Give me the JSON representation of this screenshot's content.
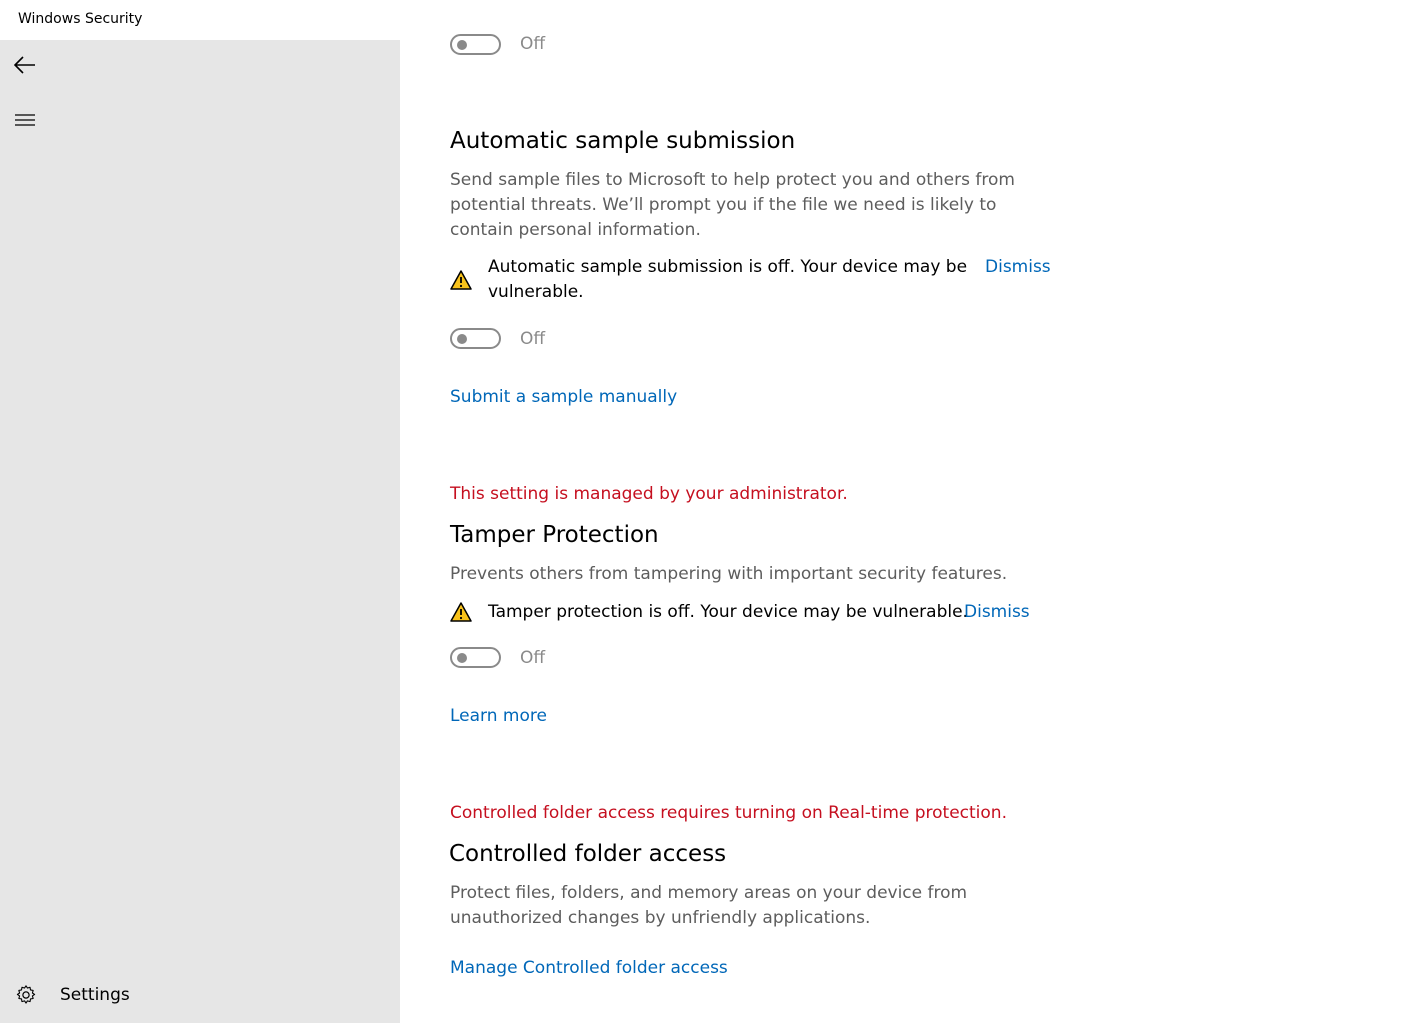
{
  "window": {
    "title": "Windows Security"
  },
  "sidebar": {
    "back_icon": "back-arrow-icon",
    "menu_icon": "hamburger-menu-icon",
    "settings_icon": "gear-icon",
    "settings_label": "Settings"
  },
  "colors": {
    "link": "#0067b8",
    "admin_note": "#c50f1f",
    "warning_icon": "#f8c21b",
    "sidebar_bg": "#e6e6e6"
  },
  "top_toggle": {
    "state": "Off"
  },
  "sample_submission": {
    "heading": "Automatic sample submission",
    "description": "Send sample files to Microsoft to help protect you and others from potential threats. We’ll prompt you if the file we need is likely to contain personal information.",
    "warning_icon": "warning-triangle-icon",
    "warning": "Automatic sample submission is off. Your device may be vulnerable.",
    "dismiss": "Dismiss",
    "toggle_state": "Off",
    "link": "Submit a sample manually"
  },
  "tamper_protection": {
    "admin_note": "This setting is managed by your administrator.",
    "heading": "Tamper Protection",
    "description": "Prevents others from tampering with important security features.",
    "warning_icon": "warning-triangle-icon",
    "warning": "Tamper protection is off. Your device may be vulnerable.",
    "dismiss": "Dismiss",
    "toggle_state": "Off",
    "link": "Learn more"
  },
  "controlled_folder": {
    "admin_note": "Controlled folder access requires turning on Real-time protection.",
    "heading": "Controlled folder access",
    "description": "Protect files, folders, and memory areas on your device from unauthorized changes by unfriendly applications.",
    "link": "Manage Controlled folder access"
  }
}
